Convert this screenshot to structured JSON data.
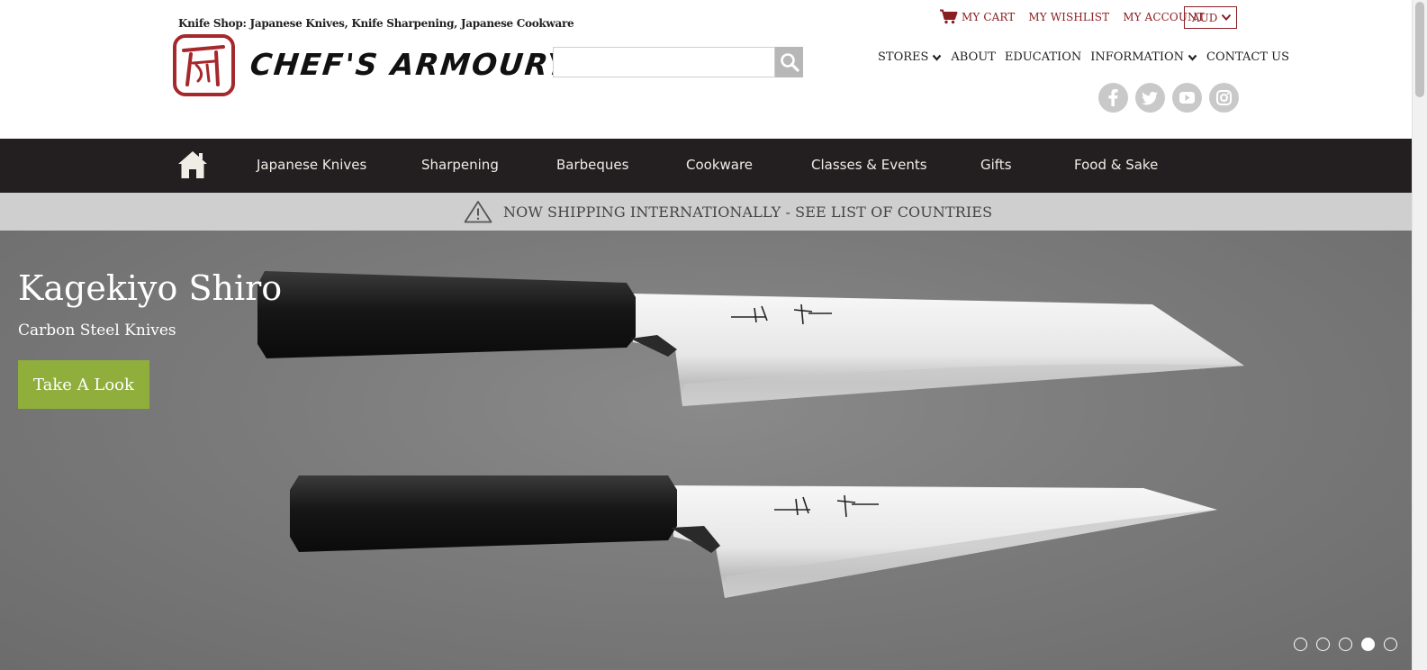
{
  "header": {
    "tagline": "Knife Shop: Japanese Knives, Knife Sharpening, Japanese Cookware",
    "logo_text": "CHEF'S ARMOURY",
    "search": {
      "value": "",
      "placeholder": ""
    },
    "top_links": {
      "cart": "MY CART",
      "wishlist": "MY WISHLIST",
      "account": "MY ACCOUNT"
    },
    "currency": "AUD",
    "secondary_nav": {
      "stores": "STORES",
      "about": "ABOUT",
      "education": "EDUCATION",
      "information": "INFORMATION",
      "contact": "CONTACT US"
    },
    "social_icons": [
      "facebook-icon",
      "twitter-icon",
      "youtube-icon",
      "instagram-icon"
    ]
  },
  "main_nav": {
    "items": [
      {
        "label": "Japanese Knives"
      },
      {
        "label": "Sharpening"
      },
      {
        "label": "Barbeques"
      },
      {
        "label": "Cookware"
      },
      {
        "label": "Classes & Events"
      },
      {
        "label": "Gifts"
      },
      {
        "label": "Food & Sake"
      }
    ]
  },
  "shipping_banner": {
    "text": "NOW SHIPPING INTERNATIONALLY - SEE LIST OF COUNTRIES"
  },
  "hero": {
    "title": "Kagekiyo Shiro",
    "subtitle": "Carbon Steel Knives",
    "button": "Take A Look",
    "slides_total": 5,
    "active_slide": 4
  },
  "colors": {
    "brand_red": "#8a1f23",
    "nav_bg": "#231f20",
    "button_green": "#8fae3c",
    "shipping_bar": "#cfcfcf"
  }
}
